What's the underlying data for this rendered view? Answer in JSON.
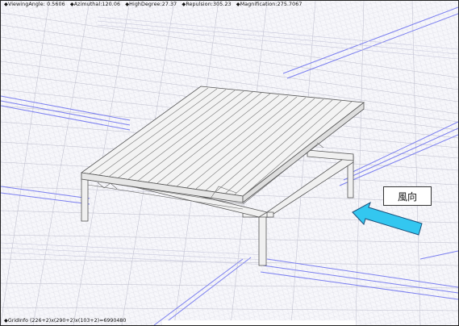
{
  "status": {
    "viewing_angle": "◆ViewingAngle: 0.5606",
    "azimuthal": "◆Azimuthal:120.06",
    "high_degree": "◆HighDegree:27.37",
    "repulsion": "◆Repulsion:305.23",
    "magnification": "◆Magnification:275.7067"
  },
  "grid_info": "◆GridInfo  (226+2)x(290+2)x(103+2)=6990480",
  "wind_label": "風向",
  "colors": {
    "mesh_line": "#c9c9d6",
    "band_line": "#7b7ff0",
    "model_fill": "#f2f2f2",
    "model_edge": "#555555",
    "arrow_fill": "#33c7f0",
    "arrow_edge": "#1b4f7a"
  }
}
